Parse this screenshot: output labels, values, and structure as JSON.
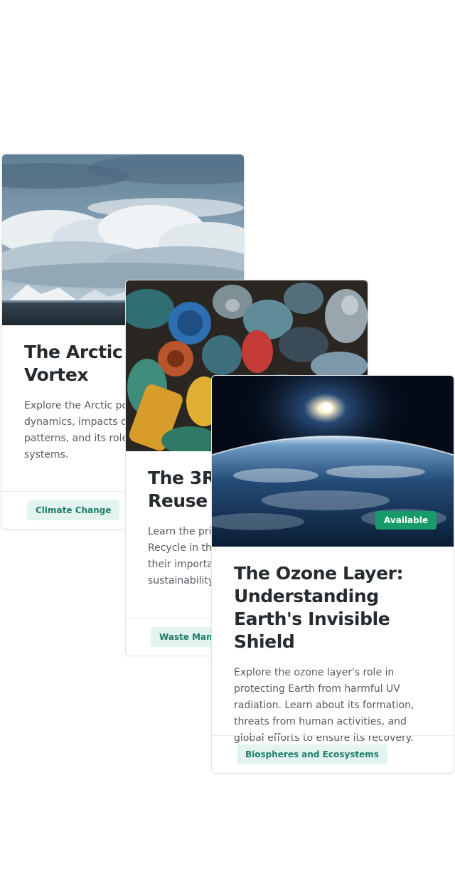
{
  "cards": [
    {
      "title": "The Arctic Polar Vortex",
      "description": "Explore the Arctic polar vortex, its dynamics, impacts on weather patterns, and its role in global climate systems.",
      "tag": "Climate Change",
      "image_icon": "clouds-over-arctic-sea-image"
    },
    {
      "title": "The 3Rs: Reduce, Reuse and Recycle",
      "description": "Learn the principles of Reduce, Reuse, Recycle in the waste hierarchy and their importance for environmental sustainability.",
      "tag": "Waste Management",
      "image_icon": "crushed-cans-image"
    },
    {
      "title": "The Ozone Layer: Understanding Earth's Invisible Shield",
      "description": "Explore the ozone layer's role in protecting Earth from harmful UV radiation. Learn about its formation, threats from human activities, and global efforts to ensure its recovery.",
      "tag": "Biospheres and Ecosystems",
      "badge": "Available",
      "image_icon": "earth-from-space-image"
    }
  ],
  "colors": {
    "tag_background": "#e3f3ef",
    "tag_text": "#1b8066",
    "badge_background": "#179b6a",
    "title_text": "#262b30",
    "body_text": "#555b62"
  }
}
